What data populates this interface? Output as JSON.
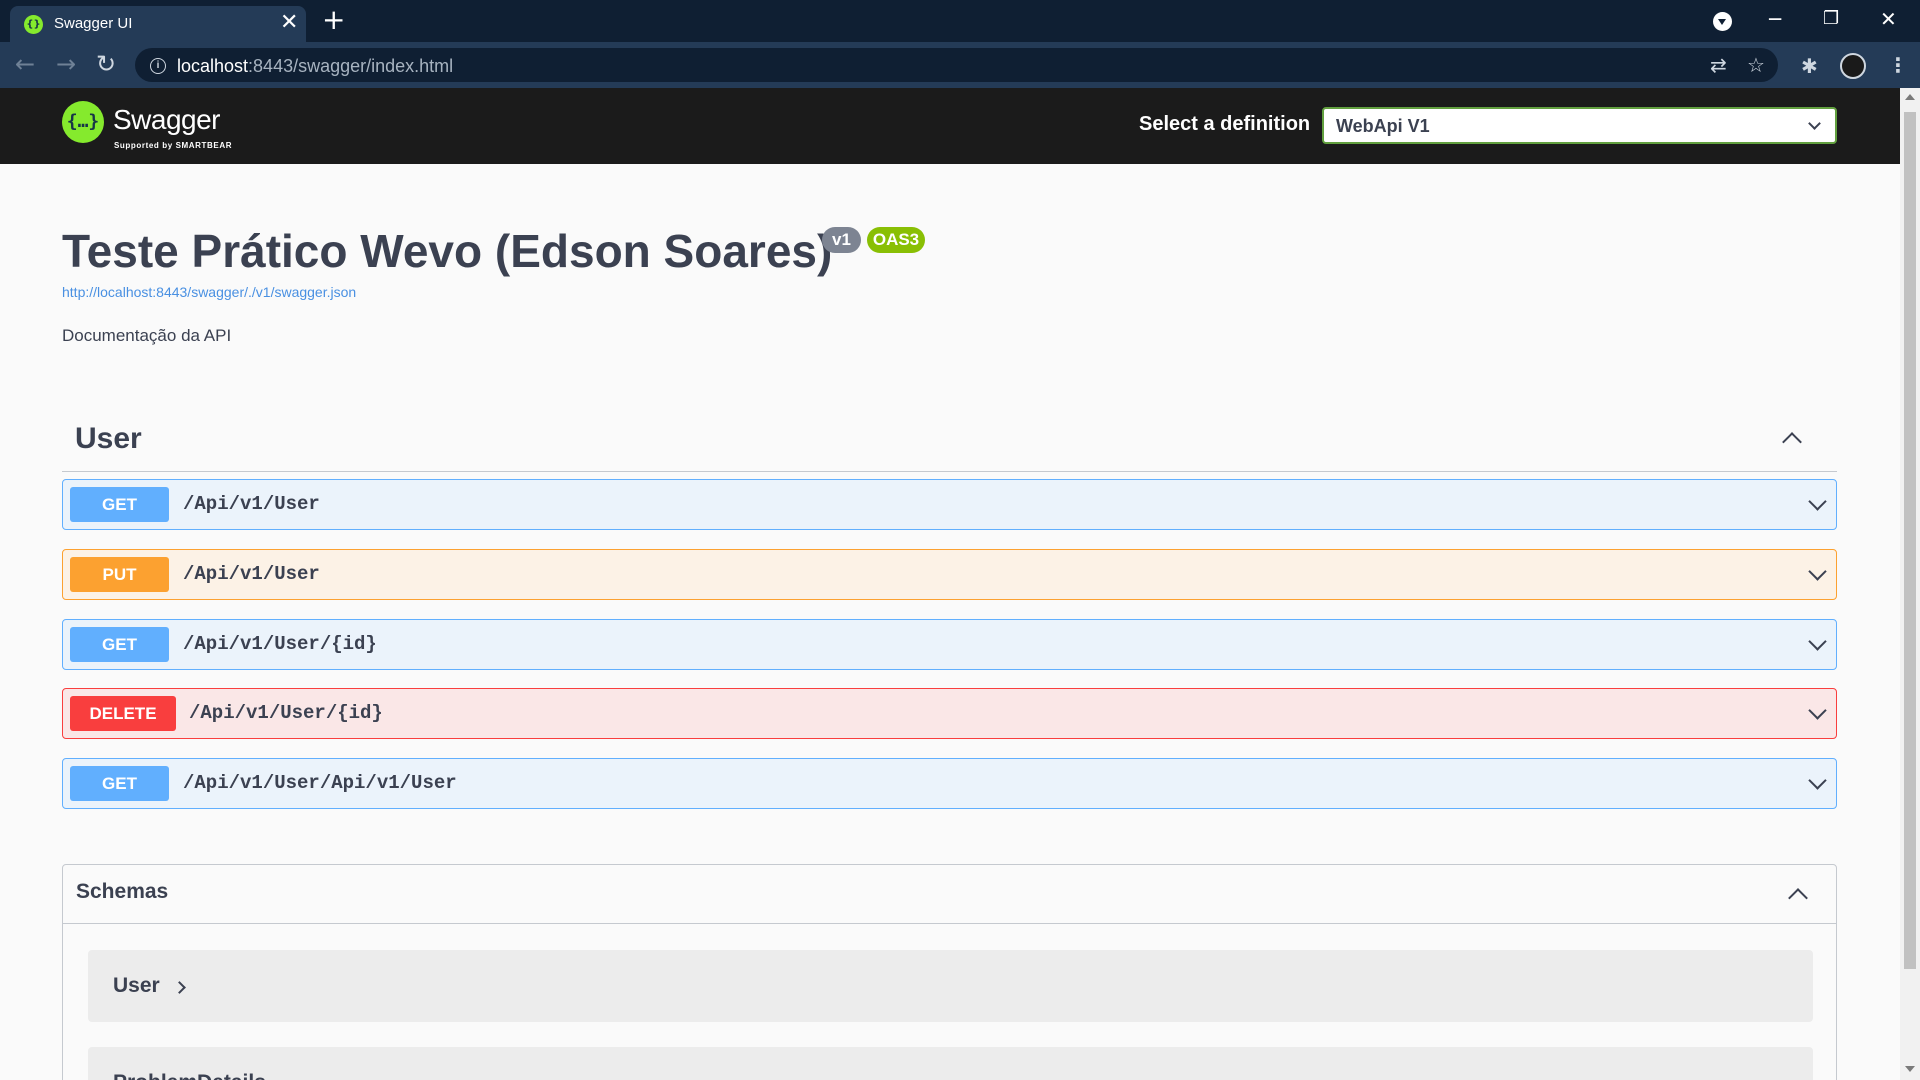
{
  "browser": {
    "tab_title": "Swagger UI",
    "tab_close": "✕",
    "new_tab": "+",
    "url_host": "localhost",
    "url_rest": ":8443/swagger/index.html",
    "back_glyph": "←",
    "forward_glyph": "→",
    "reload_glyph": "↻",
    "minimize_glyph": "─",
    "restore_glyph": "❐",
    "close_glyph": "✕",
    "translate_glyph": "⇄",
    "star_glyph": "☆",
    "extensions_glyph": "✱",
    "menu_glyph": "⋮",
    "info_glyph": "i"
  },
  "topbar": {
    "logo_mark": "{…}",
    "logo_name": "Swagger",
    "logo_sub": "Supported by SMARTBEAR",
    "definition_label": "Select a definition",
    "definition_value": "WebApi V1"
  },
  "info": {
    "title": "Teste Prático Wevo (Edson Soares)",
    "version_badge": "v1",
    "oas_badge": "OAS3",
    "spec_link": "http://localhost:8443/swagger/./v1/swagger.json",
    "description": "Documentação da API"
  },
  "tag": {
    "name": "User",
    "operations": [
      {
        "method": "GET",
        "path": "/Api/v1/User"
      },
      {
        "method": "PUT",
        "path": "/Api/v1/User"
      },
      {
        "method": "GET",
        "path": "/Api/v1/User/{id}"
      },
      {
        "method": "DELETE",
        "path": "/Api/v1/User/{id}"
      },
      {
        "method": "GET",
        "path": "/Api/v1/User/Api/v1/User"
      }
    ]
  },
  "schemas": {
    "title": "Schemas",
    "models": [
      "User",
      "ProblemDetails"
    ]
  },
  "colors": {
    "get": "#61affe",
    "put": "#fca130",
    "delete": "#f93e3e",
    "swagger_green": "#85ea2d",
    "text": "#3b4151"
  }
}
